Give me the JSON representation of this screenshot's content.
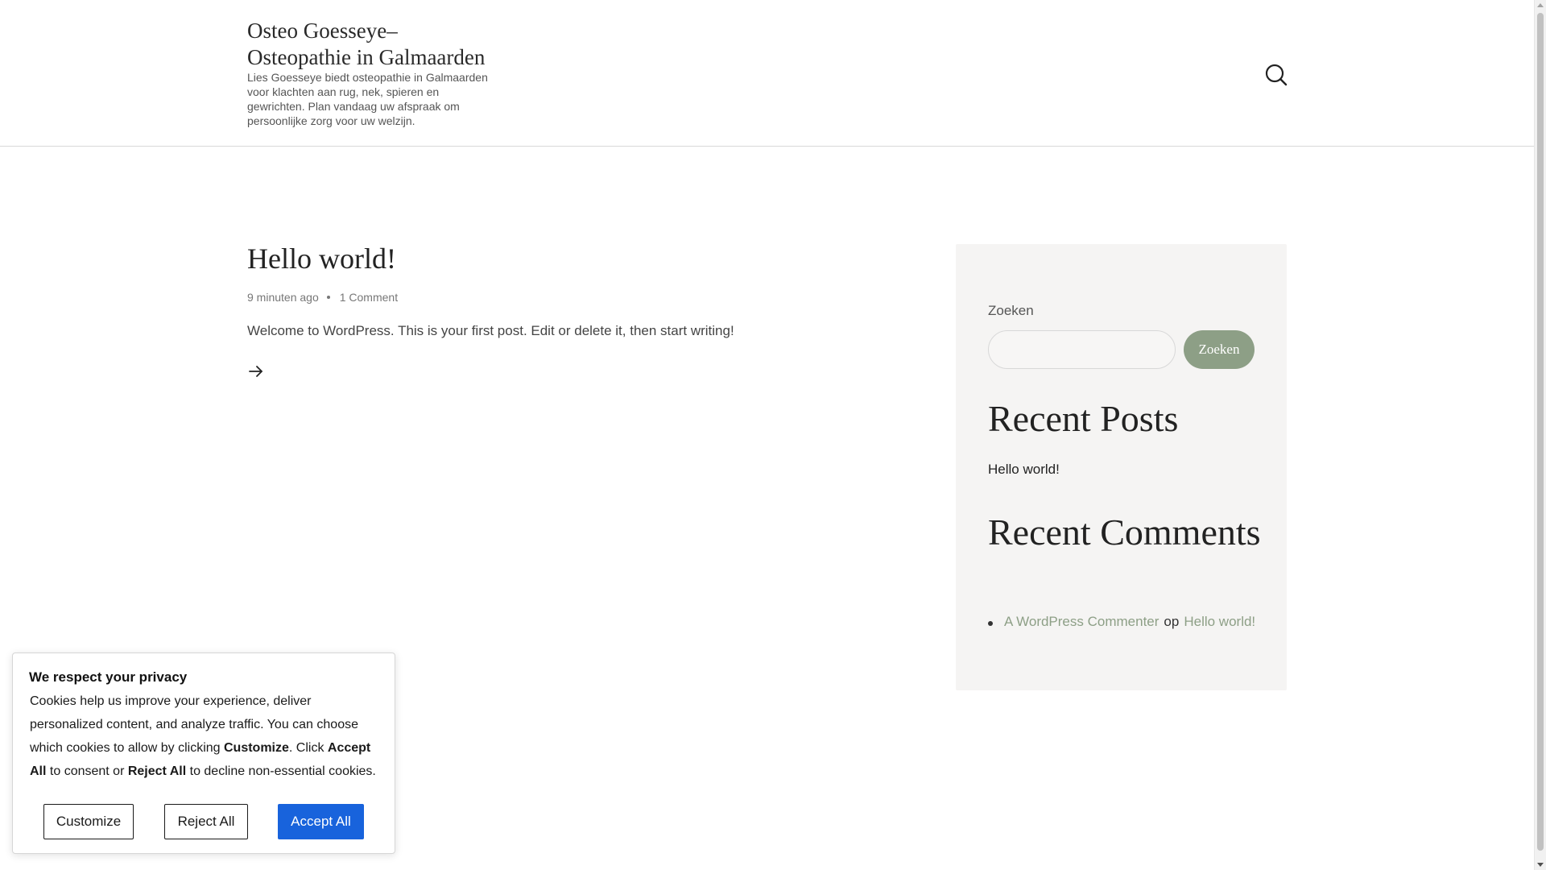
{
  "header": {
    "site_title": "Osteo Goesseye– Osteopathie in Galmaarden",
    "site_description": "Lies Goesseye biedt osteopathie in Galmaarden voor klachten aan rug, nek, spieren en gewrichten. Plan vandaag uw afspraak om persoonlijke zorg voor uw welzijn.",
    "search_icon": "search-icon"
  },
  "post": {
    "title": "Hello world!",
    "time_ago": "9 minuten ago",
    "comments": "1 Comment",
    "excerpt": "Welcome to WordPress. This is your first post. Edit or delete it, then start writing!",
    "read_more_icon": "arrow-right-icon"
  },
  "sidebar": {
    "search_label": "Zoeken",
    "search_value": "",
    "search_button": "Zoeken",
    "recent_posts_heading": "Recent Posts",
    "recent_posts": [
      "Hello world!"
    ],
    "recent_comments_heading": "Recent Comments",
    "recent_comment": {
      "author": "A WordPress Commenter",
      "connector": "op",
      "post": "Hello world!"
    }
  },
  "cookie_banner": {
    "title": "We respect your privacy",
    "text_1": "Cookies help us improve your experience, deliver personalized content, and analyze traffic. You can choose which cookies to allow by clicking ",
    "bold_customize": "Customize",
    "text_2": ". Click ",
    "bold_accept": "Accept All",
    "text_3": " to consent or ",
    "bold_reject": "Reject All",
    "text_4": " to decline non-essential cookies.",
    "customize_label": "Customize",
    "reject_label": "Reject All",
    "accept_label": "Accept All"
  },
  "colors": {
    "accent": "#8d9f86",
    "accept_button": "#1863dc",
    "sidebar_bg": "#f5f4f3"
  }
}
